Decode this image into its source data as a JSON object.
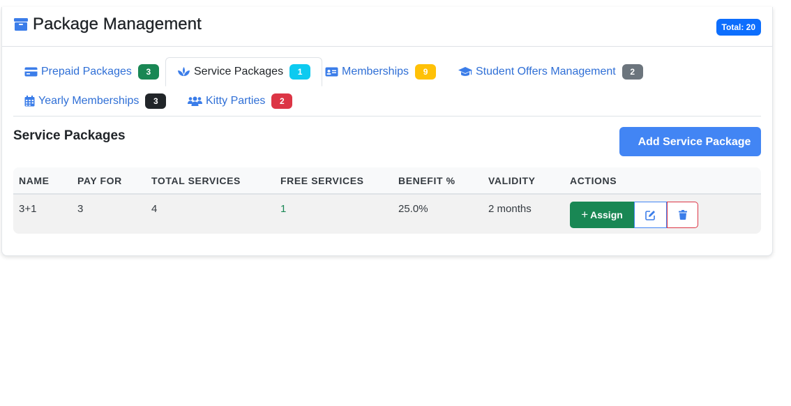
{
  "header": {
    "title": "Package Management",
    "total_label": "Total: 20",
    "icon": "box-icon"
  },
  "tabs": [
    {
      "label": "Prepaid Packages",
      "count": "3",
      "icon": "credit-card-icon",
      "badge_color": "#198754",
      "active": false
    },
    {
      "label": "Service Packages",
      "count": "1",
      "icon": "spa-icon",
      "badge_color": "#0dcaf0",
      "active": true
    },
    {
      "label": "Memberships",
      "count": "9",
      "icon": "id-card-icon",
      "badge_color": "#ffc107",
      "active": false
    },
    {
      "label": "Student Offers Management",
      "count": "2",
      "icon": "graduation-cap-icon",
      "badge_color": "#6c757d",
      "active": false
    },
    {
      "label": "Yearly Memberships",
      "count": "3",
      "icon": "calendar-icon",
      "badge_color": "#212529",
      "active": false
    },
    {
      "label": "Kitty Parties",
      "count": "2",
      "icon": "users-icon",
      "badge_color": "#dc3545",
      "active": false
    }
  ],
  "section": {
    "title": "Service Packages",
    "add_button_label": "Add Service Package"
  },
  "table": {
    "columns": [
      "NAME",
      "PAY FOR",
      "TOTAL SERVICES",
      "FREE SERVICES",
      "BENEFIT %",
      "VALIDITY",
      "ACTIONS"
    ],
    "rows": [
      {
        "name": "3+1",
        "pay_for": "3",
        "total_services": "4",
        "free_services": "1",
        "benefit": "25.0%",
        "validity": "2 months",
        "assign_label": "Assign"
      }
    ]
  },
  "colors": {
    "primary": "#0d6efd",
    "accent_blue": "#4285f4",
    "success": "#198754",
    "danger": "#dc3545",
    "link": "#2f6fd6"
  }
}
